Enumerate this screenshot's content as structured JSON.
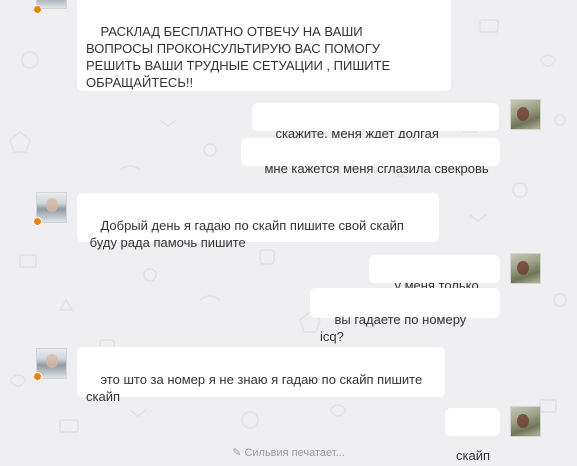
{
  "messages": [
    {
      "direction": "in",
      "text": "РАСКЛАД БЕСПЛАТНО ОТВЕЧУ НА ВАШИ\nВОПРОСЫ ПРОКОНСУЛЬТИРУЮ ВАС ПОМОГУ\nРЕШИТЬ ВАШИ ТРУДНЫЕ СЕТУАЦИИ , ПИШИТЕ\nОБРАЩАЙТЕСЬ!!"
    },
    {
      "direction": "out",
      "text": "скажите, меня ждет долгая дорога?"
    },
    {
      "direction": "out",
      "text": "мне кажется меня сглазила свекровь"
    },
    {
      "direction": "in",
      "text": "Добрый день я гадаю по скайп пишите свой скайп\n буду рада памочь пишите"
    },
    {
      "direction": "out",
      "text": "у меня только icq"
    },
    {
      "direction": "out",
      "text": "вы гадаете по номеру icq?"
    },
    {
      "direction": "in",
      "text": "это што за номер я не знаю я гадаю по скайп пишите\nскайп"
    },
    {
      "direction": "out",
      "text": "скайп"
    }
  ],
  "typing_indicator": {
    "icon": "pencil-icon",
    "text": "Сильвия печатает..."
  },
  "colors": {
    "background": "#efeff1",
    "bubble": "#ffffff",
    "text": "#333333",
    "online_status": "#ee8208",
    "typing_text": "#9a9a9a"
  }
}
